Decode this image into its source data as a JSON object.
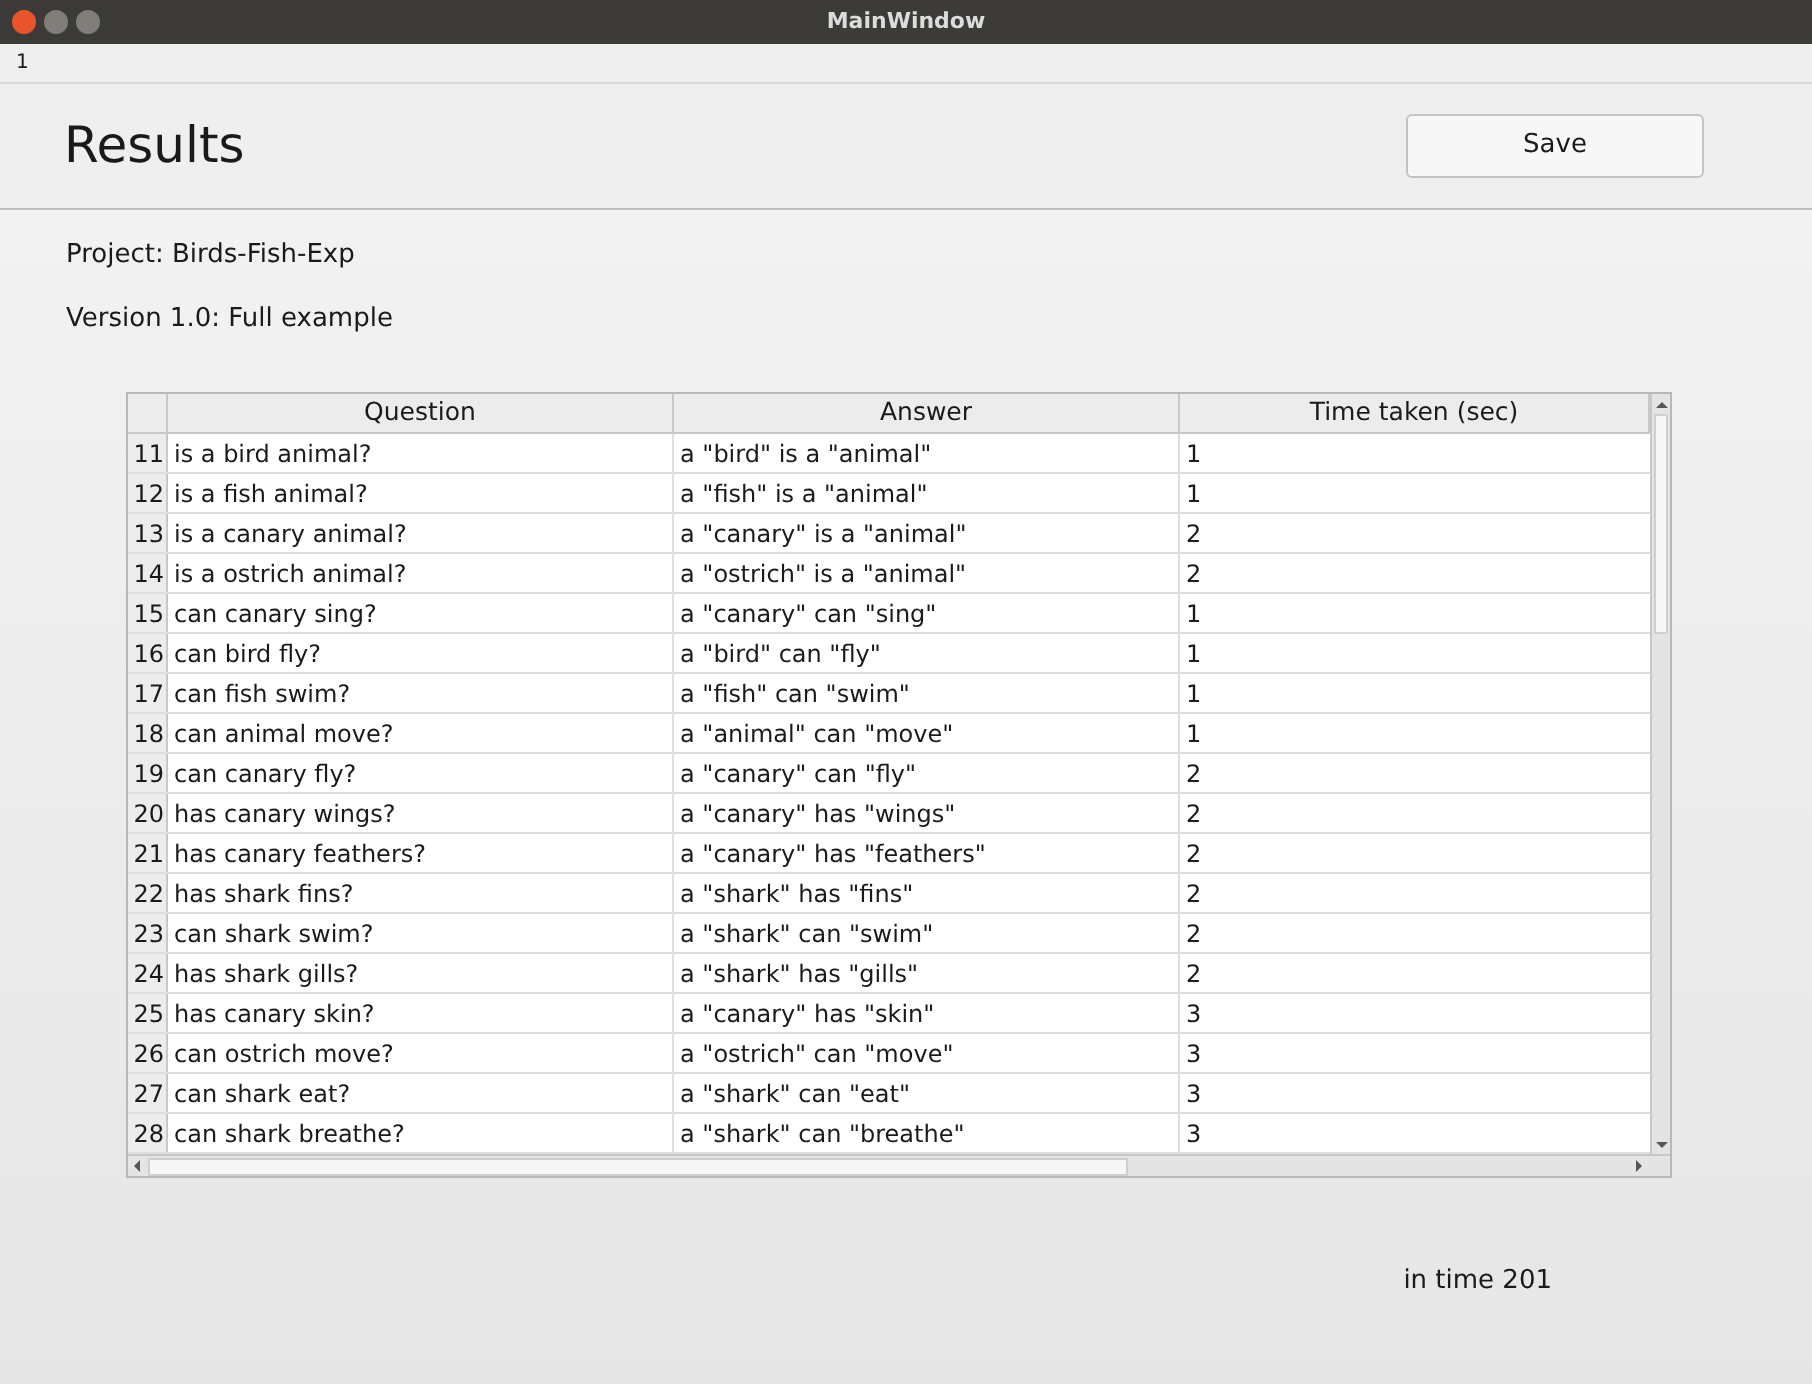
{
  "window": {
    "title": "MainWindow"
  },
  "menu_bar": {
    "label": "1"
  },
  "header": {
    "title": "Results",
    "save_button": "Save"
  },
  "project": "Project: Birds-Fish-Exp",
  "version": "Version 1.0: Full example",
  "table": {
    "columns": [
      "Question",
      "Answer",
      "Time taken (sec)"
    ],
    "rows": [
      {
        "number": "11",
        "question": "is a bird animal?",
        "answer": "a \"bird\" is a \"animal\"",
        "time": "1"
      },
      {
        "number": "12",
        "question": "is a fish animal?",
        "answer": "a \"fish\" is a \"animal\"",
        "time": "1"
      },
      {
        "number": "13",
        "question": "is a canary animal?",
        "answer": "a \"canary\" is a \"animal\"",
        "time": "2"
      },
      {
        "number": "14",
        "question": "is a ostrich animal?",
        "answer": "a \"ostrich\" is a \"animal\"",
        "time": "2"
      },
      {
        "number": "15",
        "question": "can canary sing?",
        "answer": "a \"canary\" can \"sing\"",
        "time": "1"
      },
      {
        "number": "16",
        "question": "can bird fly?",
        "answer": "a \"bird\" can \"fly\"",
        "time": "1"
      },
      {
        "number": "17",
        "question": "can fish swim?",
        "answer": "a \"fish\" can \"swim\"",
        "time": "1"
      },
      {
        "number": "18",
        "question": "can animal move?",
        "answer": "a \"animal\" can \"move\"",
        "time": "1"
      },
      {
        "number": "19",
        "question": "can canary fly?",
        "answer": "a \"canary\" can \"fly\"",
        "time": "2"
      },
      {
        "number": "20",
        "question": "has canary wings?",
        "answer": "a \"canary\" has \"wings\"",
        "time": "2"
      },
      {
        "number": "21",
        "question": "has canary feathers?",
        "answer": "a \"canary\" has \"feathers\"",
        "time": "2"
      },
      {
        "number": "22",
        "question": "has shark fins?",
        "answer": "a \"shark\" has \"fins\"",
        "time": "2"
      },
      {
        "number": "23",
        "question": "can shark swim?",
        "answer": "a \"shark\" can \"swim\"",
        "time": "2"
      },
      {
        "number": "24",
        "question": "has shark gills?",
        "answer": "a \"shark\" has \"gills\"",
        "time": "2"
      },
      {
        "number": "25",
        "question": "has canary skin?",
        "answer": "a \"canary\" has \"skin\"",
        "time": "3"
      },
      {
        "number": "26",
        "question": "can ostrich move?",
        "answer": "a \"ostrich\" can \"move\"",
        "time": "3"
      },
      {
        "number": "27",
        "question": "can shark eat?",
        "answer": "a \"shark\" can \"eat\"",
        "time": "3"
      },
      {
        "number": "28",
        "question": "can shark breathe?",
        "answer": "a \"shark\" can \"breathe\"",
        "time": "3"
      }
    ]
  },
  "footer": "in time 201"
}
